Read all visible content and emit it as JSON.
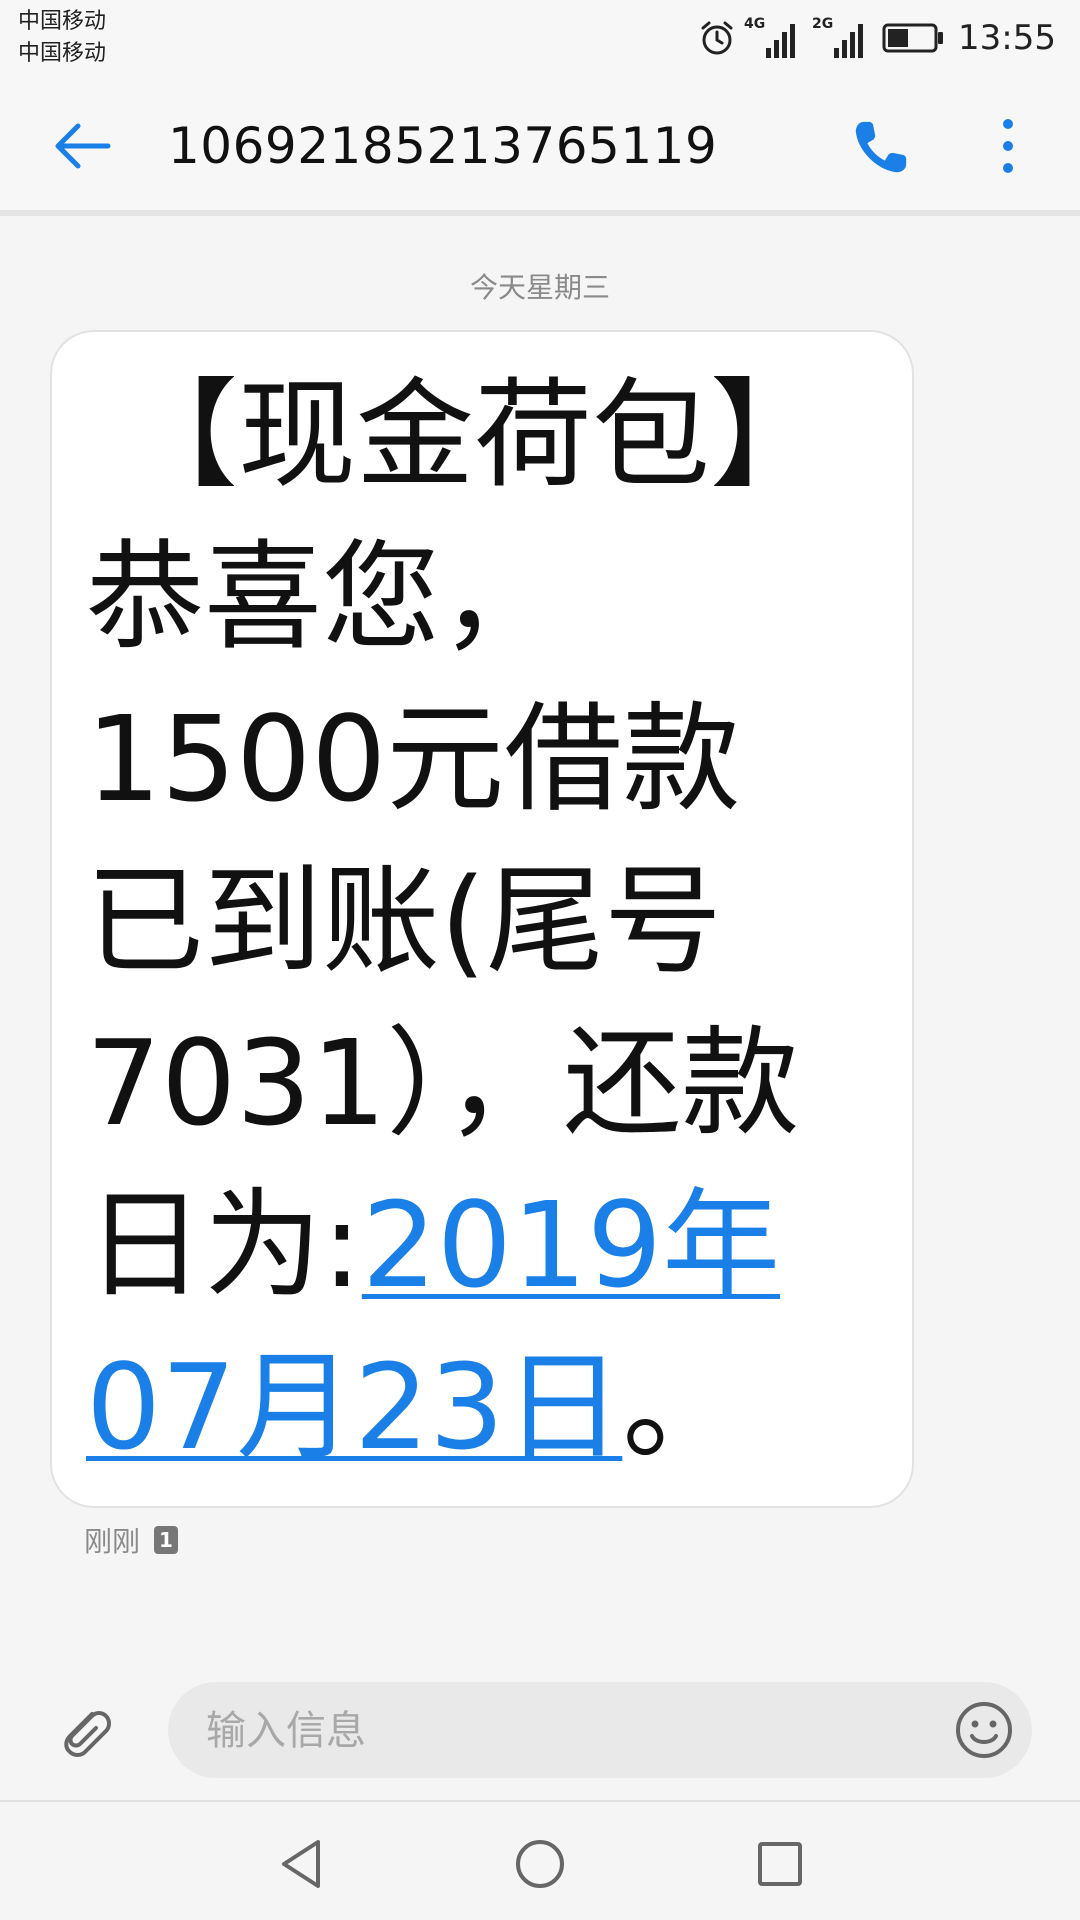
{
  "status_bar": {
    "carrier_1": "中国移动",
    "carrier_2": "中国移动",
    "net_1": "4G",
    "net_2": "2G",
    "battery_level": 0.45,
    "time": "13:55"
  },
  "header": {
    "title": "10692185213765119"
  },
  "conversation": {
    "date_label": "今天星期三",
    "message": {
      "lines": [
        "【现金荷包】",
        "恭喜您，",
        "1500元借款",
        "已到账(尾号",
        "7031），还款",
        "日为:"
      ],
      "link_part1": "2019年",
      "link_part2": "07月23日",
      "end_punct": "。"
    },
    "time_label": "刚刚",
    "sim_badge": "1"
  },
  "composer": {
    "placeholder": "输入信息"
  },
  "colors": {
    "accent": "#1a7fe6",
    "text": "#111111",
    "muted": "#8a8a8a"
  },
  "icons": {
    "back": "arrow-left-icon",
    "call": "phone-icon",
    "more": "more-vertical-icon",
    "attach": "paperclip-icon",
    "emoji": "smiley-icon",
    "nav_back": "triangle-back-icon",
    "nav_home": "circle-home-icon",
    "nav_recents": "square-recents-icon"
  }
}
